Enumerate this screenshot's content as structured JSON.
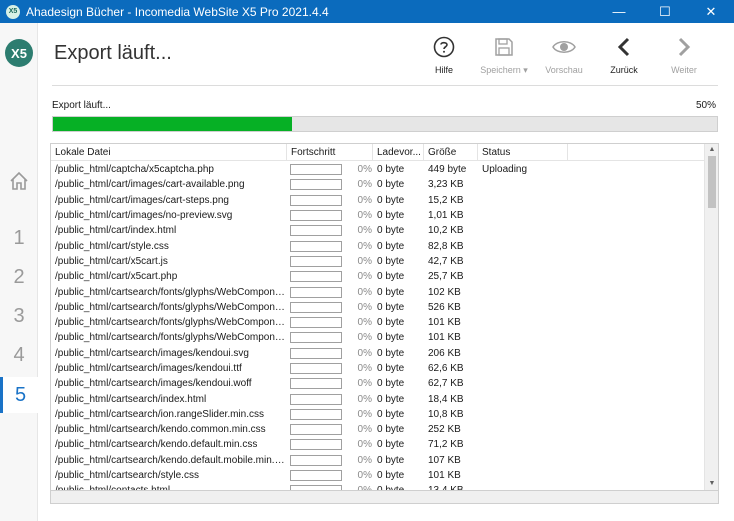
{
  "window": {
    "title": "Ahadesign Bücher - Incomedia WebSite X5 Pro 2021.4.4",
    "app_icon_text": "X5",
    "minimize_glyph": "—",
    "maximize_glyph": "☐",
    "close_glyph": "✕"
  },
  "sidebar": {
    "logo_text": "X5",
    "steps": [
      "1",
      "2",
      "3",
      "4",
      "5"
    ],
    "active_step": "5"
  },
  "header": {
    "title": "Export läuft...",
    "toolbar": {
      "help": "Hilfe",
      "save": "Speichern ▾",
      "preview": "Vorschau",
      "back": "Zurück",
      "next": "Weiter"
    }
  },
  "progress": {
    "label": "Export läuft...",
    "percent_text": "50%",
    "fraction": 0.36,
    "color": "#06b025"
  },
  "table": {
    "columns": [
      "Lokale Datei",
      "Fortschritt",
      "Ladevor...",
      "Größe",
      "Status"
    ],
    "rows": [
      {
        "file": "/public_html/captcha/x5captcha.php",
        "pct": "0%",
        "loaded": "0 byte",
        "size": "449 byte",
        "status": "Uploading"
      },
      {
        "file": "/public_html/cart/images/cart-available.png",
        "pct": "0%",
        "loaded": "0 byte",
        "size": "3,23 KB",
        "status": ""
      },
      {
        "file": "/public_html/cart/images/cart-steps.png",
        "pct": "0%",
        "loaded": "0 byte",
        "size": "15,2 KB",
        "status": ""
      },
      {
        "file": "/public_html/cart/images/no-preview.svg",
        "pct": "0%",
        "loaded": "0 byte",
        "size": "1,01 KB",
        "status": ""
      },
      {
        "file": "/public_html/cart/index.html",
        "pct": "0%",
        "loaded": "0 byte",
        "size": "10,2 KB",
        "status": ""
      },
      {
        "file": "/public_html/cart/style.css",
        "pct": "0%",
        "loaded": "0 byte",
        "size": "82,8 KB",
        "status": ""
      },
      {
        "file": "/public_html/cart/x5cart.js",
        "pct": "0%",
        "loaded": "0 byte",
        "size": "42,7 KB",
        "status": ""
      },
      {
        "file": "/public_html/cart/x5cart.php",
        "pct": "0%",
        "loaded": "0 byte",
        "size": "25,7 KB",
        "status": ""
      },
      {
        "file": "/public_html/cartsearch/fonts/glyphs/WebComponen...",
        "pct": "0%",
        "loaded": "0 byte",
        "size": "102 KB",
        "status": ""
      },
      {
        "file": "/public_html/cartsearch/fonts/glyphs/WebComponen...",
        "pct": "0%",
        "loaded": "0 byte",
        "size": "526 KB",
        "status": ""
      },
      {
        "file": "/public_html/cartsearch/fonts/glyphs/WebComponen...",
        "pct": "0%",
        "loaded": "0 byte",
        "size": "101 KB",
        "status": ""
      },
      {
        "file": "/public_html/cartsearch/fonts/glyphs/WebComponen...",
        "pct": "0%",
        "loaded": "0 byte",
        "size": "101 KB",
        "status": ""
      },
      {
        "file": "/public_html/cartsearch/images/kendoui.svg",
        "pct": "0%",
        "loaded": "0 byte",
        "size": "206 KB",
        "status": ""
      },
      {
        "file": "/public_html/cartsearch/images/kendoui.ttf",
        "pct": "0%",
        "loaded": "0 byte",
        "size": "62,6 KB",
        "status": ""
      },
      {
        "file": "/public_html/cartsearch/images/kendoui.woff",
        "pct": "0%",
        "loaded": "0 byte",
        "size": "62,7 KB",
        "status": ""
      },
      {
        "file": "/public_html/cartsearch/index.html",
        "pct": "0%",
        "loaded": "0 byte",
        "size": "18,4 KB",
        "status": ""
      },
      {
        "file": "/public_html/cartsearch/ion.rangeSlider.min.css",
        "pct": "0%",
        "loaded": "0 byte",
        "size": "10,8 KB",
        "status": ""
      },
      {
        "file": "/public_html/cartsearch/kendo.common.min.css",
        "pct": "0%",
        "loaded": "0 byte",
        "size": "252 KB",
        "status": ""
      },
      {
        "file": "/public_html/cartsearch/kendo.default.min.css",
        "pct": "0%",
        "loaded": "0 byte",
        "size": "71,2 KB",
        "status": ""
      },
      {
        "file": "/public_html/cartsearch/kendo.default.mobile.min.css",
        "pct": "0%",
        "loaded": "0 byte",
        "size": "107 KB",
        "status": ""
      },
      {
        "file": "/public_html/cartsearch/style.css",
        "pct": "0%",
        "loaded": "0 byte",
        "size": "101 KB",
        "status": ""
      },
      {
        "file": "/public_html/contacts.html",
        "pct": "0%",
        "loaded": "0 byte",
        "size": "13,4 KB",
        "status": ""
      }
    ]
  },
  "icons": {
    "help": "question-circle-icon",
    "save": "floppy-disk-icon",
    "preview": "eye-icon",
    "back": "chevron-left-icon",
    "next": "chevron-right-icon",
    "home": "home-icon"
  }
}
